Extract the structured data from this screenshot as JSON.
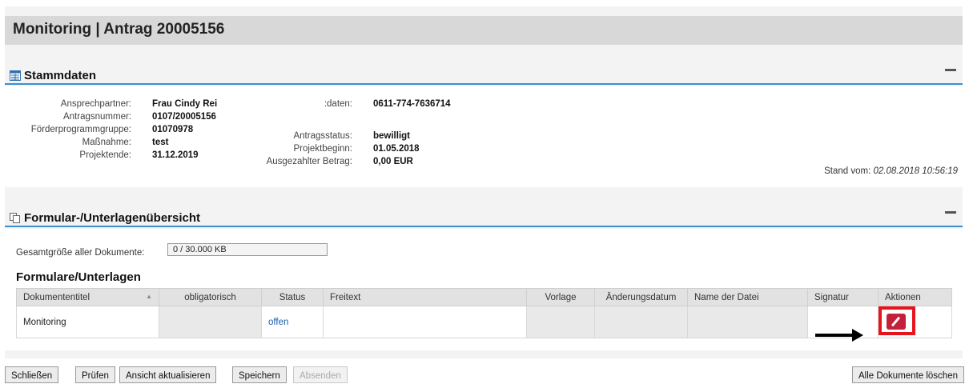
{
  "page": {
    "title": "Monitoring | Antrag 20005156"
  },
  "stammdaten": {
    "title": "Stammdaten",
    "fields_left": [
      {
        "label": "Ansprechpartner:",
        "value": "Frau Cindy Rei"
      },
      {
        "label": "Antragsnummer:",
        "value": "0107/20005156"
      },
      {
        "label": "Förderprogrammgruppe:",
        "value": "01070978"
      },
      {
        "label": "Maßnahme:",
        "value": "test"
      },
      {
        "label": "Projektende:",
        "value": "31.12.2019"
      }
    ],
    "fields_right": [
      {
        "label": ":daten:",
        "value": "0611-774-7636714"
      },
      {
        "label": "Antragsstatus:",
        "value": "bewilligt"
      },
      {
        "label": "Projektbeginn:",
        "value": "01.05.2018"
      },
      {
        "label": "Ausgezahlter Betrag:",
        "value": "0,00 EUR"
      }
    ],
    "stand_label": "Stand vom:",
    "stand_value": "02.08.2018 10:56:19"
  },
  "uebersicht": {
    "title": "Formular-/Unterlagenübersicht",
    "gesamt_label": "Gesamtgröße aller Dokumente:",
    "gesamt_value": "0 / 30.000 KB",
    "subheading": "Formulare/Unterlagen",
    "columns": [
      "Dokumententitel",
      "obligatorisch",
      "Status",
      "Freitext",
      "Vorlage",
      "Änderungsdatum",
      "Name der Datei",
      "Signatur",
      "Aktionen"
    ],
    "sort_indicator": "▲",
    "rows": [
      {
        "Dokumententitel": "Monitoring",
        "obligatorisch": "",
        "Status": "offen",
        "Freitext": "",
        "Vorlage": "",
        "Änderungsdatum": "",
        "Name der Datei": "",
        "Signatur": ""
      }
    ]
  },
  "buttons": {
    "schliessen": "Schließen",
    "pruefen": "Prüfen",
    "ansicht": "Ansicht aktualisieren",
    "speichern": "Speichern",
    "absenden": "Absenden",
    "alle_loeschen": "Alle Dokumente löschen"
  },
  "colors": {
    "accent_line": "#3b8fd0",
    "edit_button": "#c4203a",
    "highlight": "#e8141c",
    "link": "#1a5fb4"
  }
}
